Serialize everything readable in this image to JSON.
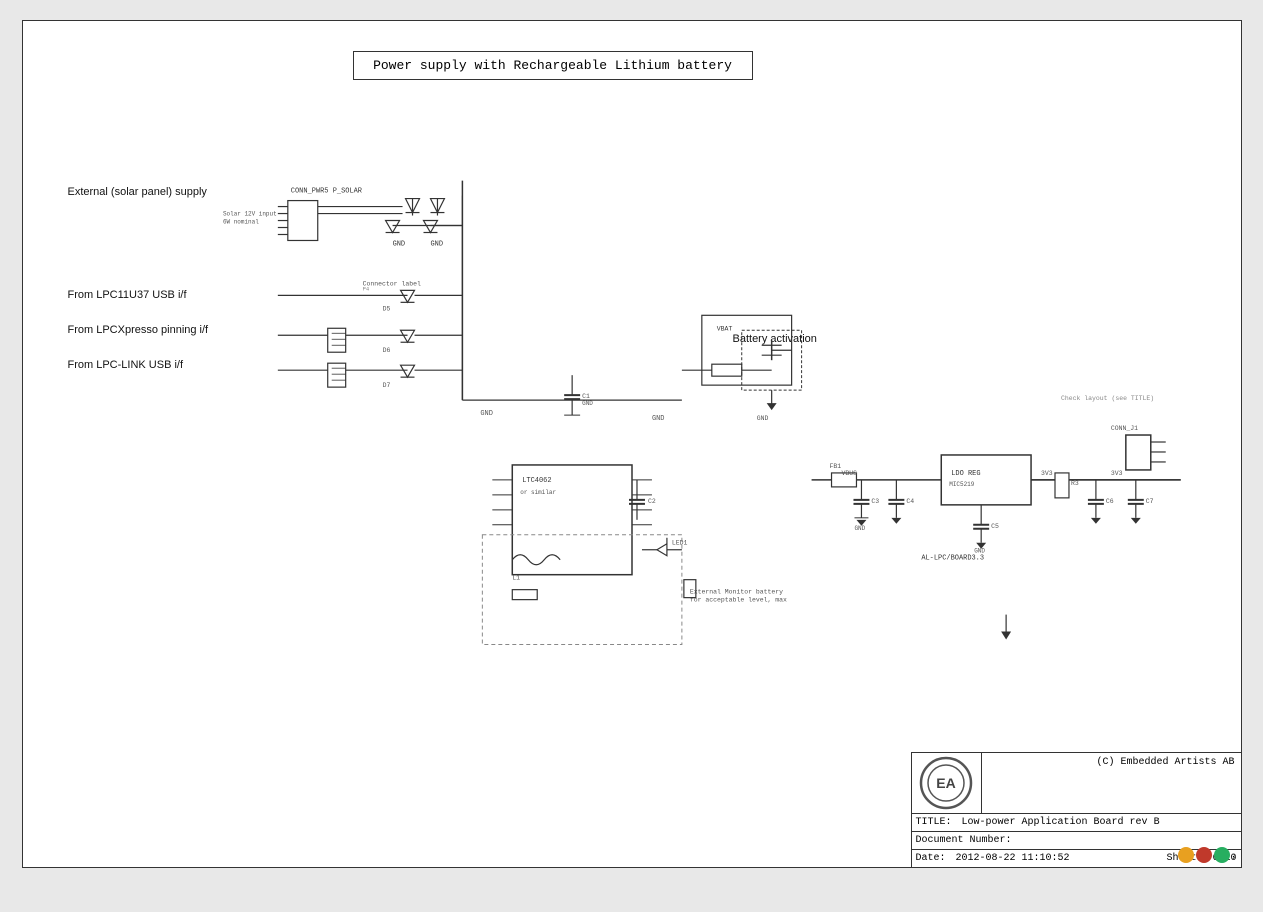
{
  "title": "Power supply with Rechargeable Lithium battery",
  "labels": {
    "external_supply": "External (solar panel) supply",
    "from_lpc11u37": "From LPC11U37 USB i/f",
    "from_lpcxpresso": "From LPCXpresso pinning i/f",
    "from_lpclink": "From LPC-LINK USB i/f",
    "battery_activation": "Battery activation"
  },
  "title_block": {
    "company": "(C) Embedded Artists AB",
    "title_label": "TITLE:",
    "title_value": "Low-power Application Board rev B",
    "doc_number_label": "Document Number:",
    "doc_number_value": "",
    "date_label": "Date:",
    "date_value": "2012-08-22  11:10:52",
    "sheet_label": "Sheet:",
    "sheet_value": "6/10"
  }
}
